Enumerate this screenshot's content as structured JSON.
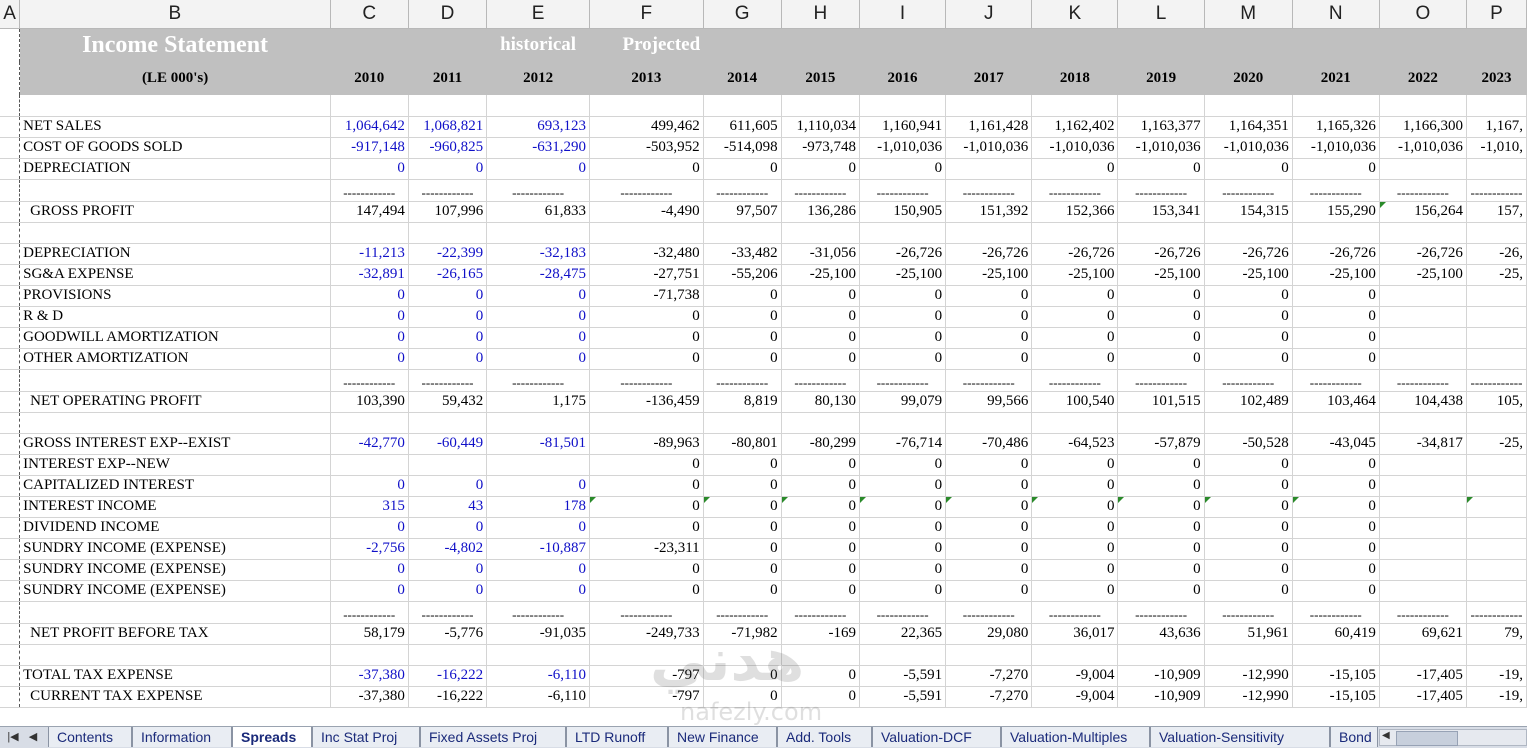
{
  "columns": [
    "A",
    "B",
    "C",
    "D",
    "E",
    "F",
    "G",
    "H",
    "I",
    "J",
    "K",
    "L",
    "M",
    "N",
    "O",
    "P"
  ],
  "title": {
    "main": "Income Statement",
    "historical": "historical",
    "projected": "Projected",
    "units": "(LE 000's)"
  },
  "years": [
    "2010",
    "2011",
    "2012",
    "2013",
    "2014",
    "2015",
    "2016",
    "2017",
    "2018",
    "2019",
    "2020",
    "2021",
    "2022",
    "2023"
  ],
  "separator": "------------",
  "rows": [
    {
      "type": "blank"
    },
    {
      "type": "data",
      "label": "NET SALES",
      "values": [
        "1,064,642",
        "1,068,821",
        "693,123",
        "499,462",
        "611,605",
        "1,110,034",
        "1,160,941",
        "1,161,428",
        "1,162,402",
        "1,163,377",
        "1,164,351",
        "1,165,326",
        "1,166,300",
        "1,167,"
      ]
    },
    {
      "type": "data",
      "label": "COST OF GOODS SOLD",
      "values": [
        "-917,148",
        "-960,825",
        "-631,290",
        "-503,952",
        "-514,098",
        "-973,748",
        "-1,010,036",
        "-1,010,036",
        "-1,010,036",
        "-1,010,036",
        "-1,010,036",
        "-1,010,036",
        "-1,010,036",
        "-1,010,"
      ]
    },
    {
      "type": "data",
      "label": "DEPRECIATION",
      "values": [
        "0",
        "0",
        "0",
        "0",
        "0",
        "0",
        "0",
        "",
        "0",
        "0",
        "0",
        "0",
        "",
        ""
      ]
    },
    {
      "type": "sep"
    },
    {
      "type": "total",
      "label": "GROSS PROFIT",
      "values": [
        "147,494",
        "107,996",
        "61,833",
        "-4,490",
        "97,507",
        "136,286",
        "150,905",
        "151,392",
        "152,366",
        "153,341",
        "154,315",
        "155,290",
        "156,264",
        "157,"
      ],
      "marks": [
        12
      ]
    },
    {
      "type": "blank"
    },
    {
      "type": "data",
      "label": "DEPRECIATION",
      "values": [
        "-11,213",
        "-22,399",
        "-32,183",
        "-32,480",
        "-33,482",
        "-31,056",
        "-26,726",
        "-26,726",
        "-26,726",
        "-26,726",
        "-26,726",
        "-26,726",
        "-26,726",
        "-26,"
      ]
    },
    {
      "type": "data",
      "label": "SG&A EXPENSE",
      "values": [
        "-32,891",
        "-26,165",
        "-28,475",
        "-27,751",
        "-55,206",
        "-25,100",
        "-25,100",
        "-25,100",
        "-25,100",
        "-25,100",
        "-25,100",
        "-25,100",
        "-25,100",
        "-25,"
      ]
    },
    {
      "type": "data",
      "label": "PROVISIONS",
      "values": [
        "0",
        "0",
        "0",
        "-71,738",
        "0",
        "0",
        "0",
        "0",
        "0",
        "0",
        "0",
        "0",
        "",
        ""
      ]
    },
    {
      "type": "data",
      "label": "R & D",
      "values": [
        "0",
        "0",
        "0",
        "0",
        "0",
        "0",
        "0",
        "0",
        "0",
        "0",
        "0",
        "0",
        "",
        ""
      ]
    },
    {
      "type": "data",
      "label": "GOODWILL AMORTIZATION",
      "values": [
        "0",
        "0",
        "0",
        "0",
        "0",
        "0",
        "0",
        "0",
        "0",
        "0",
        "0",
        "0",
        "",
        ""
      ]
    },
    {
      "type": "data",
      "label": "OTHER AMORTIZATION",
      "values": [
        "0",
        "0",
        "0",
        "0",
        "0",
        "0",
        "0",
        "0",
        "0",
        "0",
        "0",
        "0",
        "",
        ""
      ]
    },
    {
      "type": "sep"
    },
    {
      "type": "total",
      "label": "NET OPERATING PROFIT",
      "values": [
        "103,390",
        "59,432",
        "1,175",
        "-136,459",
        "8,819",
        "80,130",
        "99,079",
        "99,566",
        "100,540",
        "101,515",
        "102,489",
        "103,464",
        "104,438",
        "105,"
      ]
    },
    {
      "type": "blank"
    },
    {
      "type": "data",
      "label": "GROSS INTEREST EXP--EXIST",
      "values": [
        "-42,770",
        "-60,449",
        "-81,501",
        "-89,963",
        "-80,801",
        "-80,299",
        "-76,714",
        "-70,486",
        "-64,523",
        "-57,879",
        "-50,528",
        "-43,045",
        "-34,817",
        "-25,"
      ]
    },
    {
      "type": "data",
      "label": "INTEREST EXP--NEW",
      "values": [
        "",
        "",
        "",
        "0",
        "0",
        "0",
        "0",
        "0",
        "0",
        "0",
        "0",
        "0",
        "",
        ""
      ]
    },
    {
      "type": "data",
      "label": "CAPITALIZED INTEREST",
      "values": [
        "0",
        "0",
        "0",
        "0",
        "0",
        "0",
        "0",
        "0",
        "0",
        "0",
        "0",
        "0",
        "",
        ""
      ]
    },
    {
      "type": "data",
      "label": "INTEREST INCOME",
      "values": [
        "315",
        "43",
        "178",
        "0",
        "0",
        "0",
        "0",
        "0",
        "0",
        "0",
        "0",
        "0",
        "",
        ""
      ],
      "marks": [
        3,
        4,
        5,
        6,
        7,
        8,
        9,
        10,
        11,
        13
      ]
    },
    {
      "type": "data",
      "label": "DIVIDEND INCOME",
      "values": [
        "0",
        "0",
        "0",
        "0",
        "0",
        "0",
        "0",
        "0",
        "0",
        "0",
        "0",
        "0",
        "",
        ""
      ]
    },
    {
      "type": "data",
      "label": "SUNDRY INCOME (EXPENSE)",
      "values": [
        "-2,756",
        "-4,802",
        "-10,887",
        "-23,311",
        "0",
        "0",
        "0",
        "0",
        "0",
        "0",
        "0",
        "0",
        "",
        ""
      ]
    },
    {
      "type": "data",
      "label": "SUNDRY INCOME (EXPENSE)",
      "values": [
        "0",
        "0",
        "0",
        "0",
        "0",
        "0",
        "0",
        "0",
        "0",
        "0",
        "0",
        "0",
        "",
        ""
      ]
    },
    {
      "type": "data",
      "label": "SUNDRY INCOME (EXPENSE)",
      "values": [
        "0",
        "0",
        "0",
        "0",
        "0",
        "0",
        "0",
        "0",
        "0",
        "0",
        "0",
        "0",
        "",
        ""
      ]
    },
    {
      "type": "sep"
    },
    {
      "type": "total",
      "label": "NET PROFIT BEFORE TAX",
      "values": [
        "58,179",
        "-5,776",
        "-91,035",
        "-249,733",
        "-71,982",
        "-169",
        "22,365",
        "29,080",
        "36,017",
        "43,636",
        "51,961",
        "60,419",
        "69,621",
        "79,"
      ]
    },
    {
      "type": "blank"
    },
    {
      "type": "data",
      "label": "TOTAL TAX EXPENSE",
      "values": [
        "-37,380",
        "-16,222",
        "-6,110",
        "-797",
        "0",
        "0",
        "-5,591",
        "-7,270",
        "-9,004",
        "-10,909",
        "-12,990",
        "-15,105",
        "-17,405",
        "-19,"
      ]
    },
    {
      "type": "total",
      "label": "CURRENT TAX EXPENSE",
      "values": [
        "-37,380",
        "-16,222",
        "-6,110",
        "-797",
        "0",
        "0",
        "-5,591",
        "-7,270",
        "-9,004",
        "-10,909",
        "-12,990",
        "-15,105",
        "-17,405",
        "-19,"
      ]
    }
  ],
  "tabs": [
    "Contents",
    "Information",
    "Spreads",
    "Inc Stat Proj",
    "Fixed Assets Proj",
    "LTD Runoff",
    "New Finance",
    "Add. Tools",
    "Valuation-DCF",
    "Valuation-Multiples",
    "Valuation-Sensitivity",
    "Bond"
  ],
  "active_tab": "Spreads",
  "nav_icons": [
    "first-sheet-icon",
    "prev-sheet-icon"
  ],
  "colors": {
    "historical_text": "#1010c8",
    "header_band": "#c0c0c0",
    "triangle": "#2a8a2a"
  }
}
